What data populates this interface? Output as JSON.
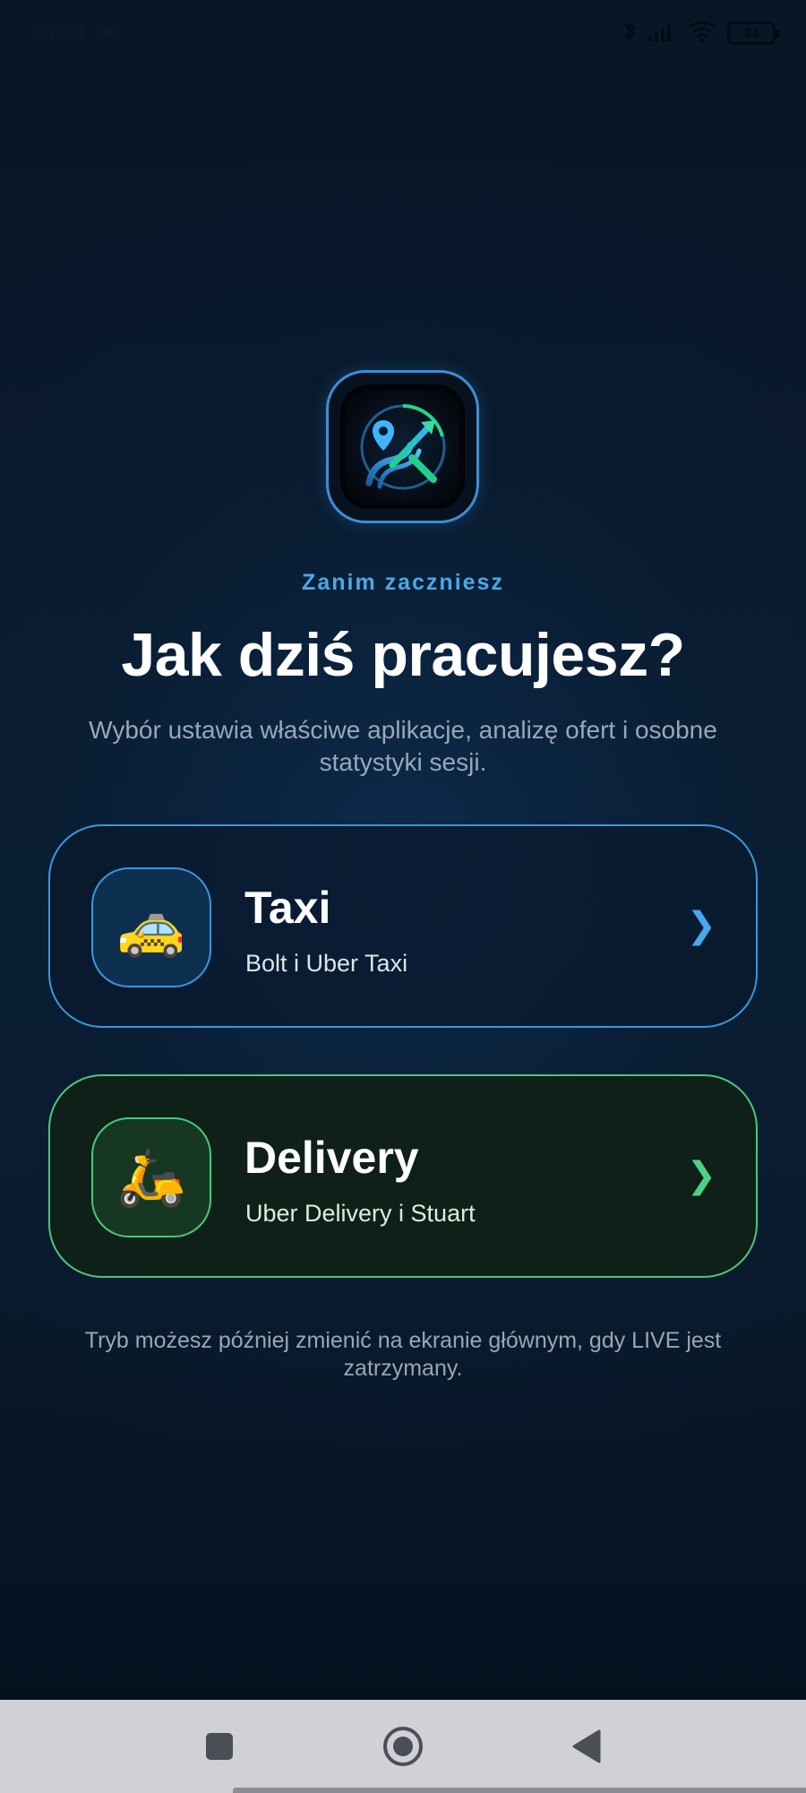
{
  "status_bar": {
    "time": "23:44",
    "battery": "33"
  },
  "header": {
    "kicker": "Zanim zaczniesz",
    "title": "Jak dziś pracujesz?",
    "subtitle": "Wybór ustawia właściwe aplikacje, analizę ofert i osobne statystyki sesji."
  },
  "modes": [
    {
      "title": "Taxi",
      "subtitle": "Bolt i Uber Taxi",
      "icon": "🚕",
      "chevron": "❯",
      "accent": "#3a97dc"
    },
    {
      "title": "Delivery",
      "subtitle": "Uber Delivery i Stuart",
      "icon": "🛵",
      "chevron": "❯",
      "accent": "#48c97a"
    }
  ],
  "footnote": "Tryb możesz później zmienić na ekranie głównym, gdy LIVE jest zatrzymany.",
  "colors": {
    "background": "#081626",
    "kicker": "#4aa8e8",
    "taxi_accent": "#3a97dc",
    "delivery_accent": "#48c97a"
  }
}
